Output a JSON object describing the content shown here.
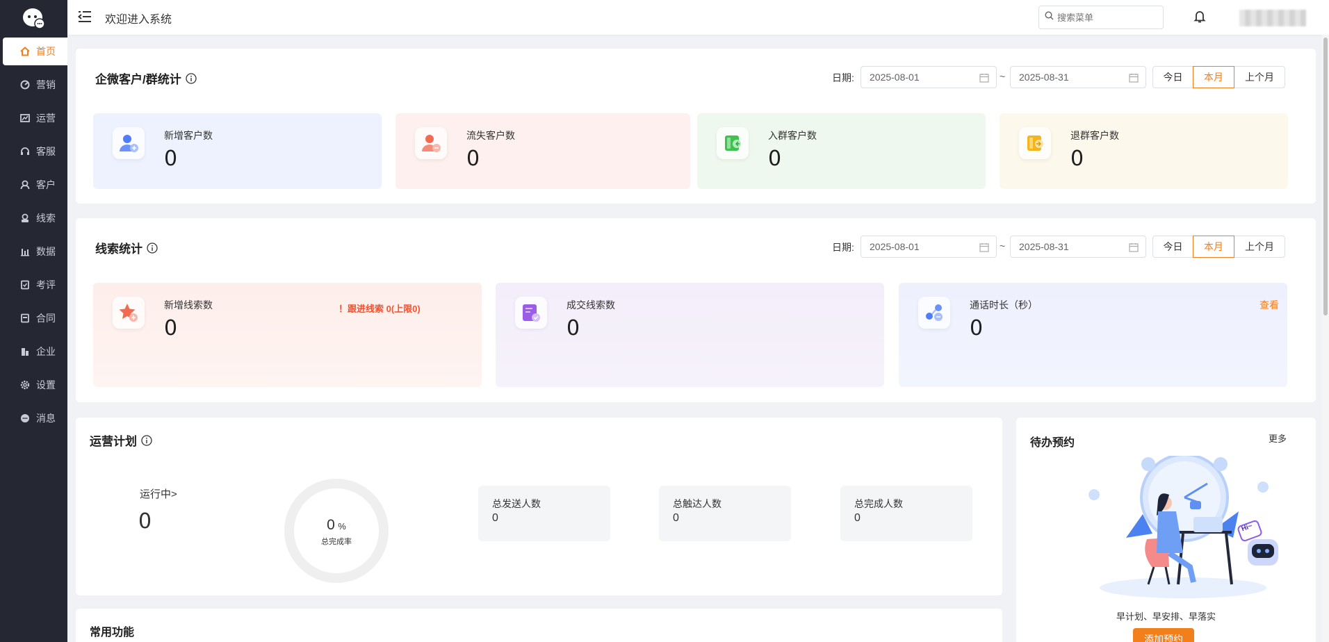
{
  "header": {
    "title": "欢迎进入系统",
    "search_placeholder": "搜索菜单"
  },
  "sidebar": {
    "items": [
      {
        "label": "首页",
        "icon": "home-icon",
        "active": true
      },
      {
        "label": "营销",
        "icon": "marketing-icon"
      },
      {
        "label": "运营",
        "icon": "operation-icon"
      },
      {
        "label": "客服",
        "icon": "headset-icon"
      },
      {
        "label": "客户",
        "icon": "customer-icon"
      },
      {
        "label": "线索",
        "icon": "clue-icon"
      },
      {
        "label": "数据",
        "icon": "chart-icon"
      },
      {
        "label": "考评",
        "icon": "evaluation-icon"
      },
      {
        "label": "合同",
        "icon": "contract-icon"
      },
      {
        "label": "企业",
        "icon": "enterprise-icon"
      },
      {
        "label": "设置",
        "icon": "gear-icon"
      },
      {
        "label": "消息",
        "icon": "message-icon"
      }
    ]
  },
  "customer_stats": {
    "title": "企微客户/群统计",
    "date_label": "日期:",
    "start_date": "2025-08-01",
    "end_date": "2025-08-31",
    "range_sep": "~",
    "buttons": [
      "今日",
      "本月",
      "上个月"
    ],
    "active_button": "本月",
    "cards": [
      {
        "label": "新增客户数",
        "value": "0",
        "color": "#eef2fe"
      },
      {
        "label": "流失客户数",
        "value": "0",
        "color": "#fdf0ee"
      },
      {
        "label": "入群客户数",
        "value": "0",
        "color": "#eef8ee"
      },
      {
        "label": "退群客户数",
        "value": "0",
        "color": "#fdf8ec"
      }
    ]
  },
  "clue_stats": {
    "title": "线索统计",
    "date_label": "日期:",
    "start_date": "2025-08-01",
    "end_date": "2025-08-31",
    "range_sep": "~",
    "buttons": [
      "今日",
      "本月",
      "上个月"
    ],
    "active_button": "本月",
    "cards": [
      {
        "label": "新增线索数",
        "value": "0",
        "warning": "！跟进线索 0(上限0)"
      },
      {
        "label": "成交线索数",
        "value": "0"
      },
      {
        "label": "通话时长（秒）",
        "value": "0",
        "link": "查看"
      }
    ]
  },
  "op_plan": {
    "title": "运营计划",
    "running_label": "运行中>",
    "running_value": "0",
    "completion_value": "0",
    "completion_unit": "%",
    "completion_label": "总完成率",
    "completion_rate": 0,
    "stats": [
      {
        "label": "总发送人数",
        "value": "0"
      },
      {
        "label": "总触达人数",
        "value": "0"
      },
      {
        "label": "总完成人数",
        "value": "0"
      }
    ]
  },
  "common": {
    "title": "常用功能"
  },
  "todo": {
    "title": "待办预约",
    "more": "更多",
    "slogan": "早计划、早安排、早落实",
    "add_button": "添加预约",
    "bubble_text": "Hi~"
  }
}
